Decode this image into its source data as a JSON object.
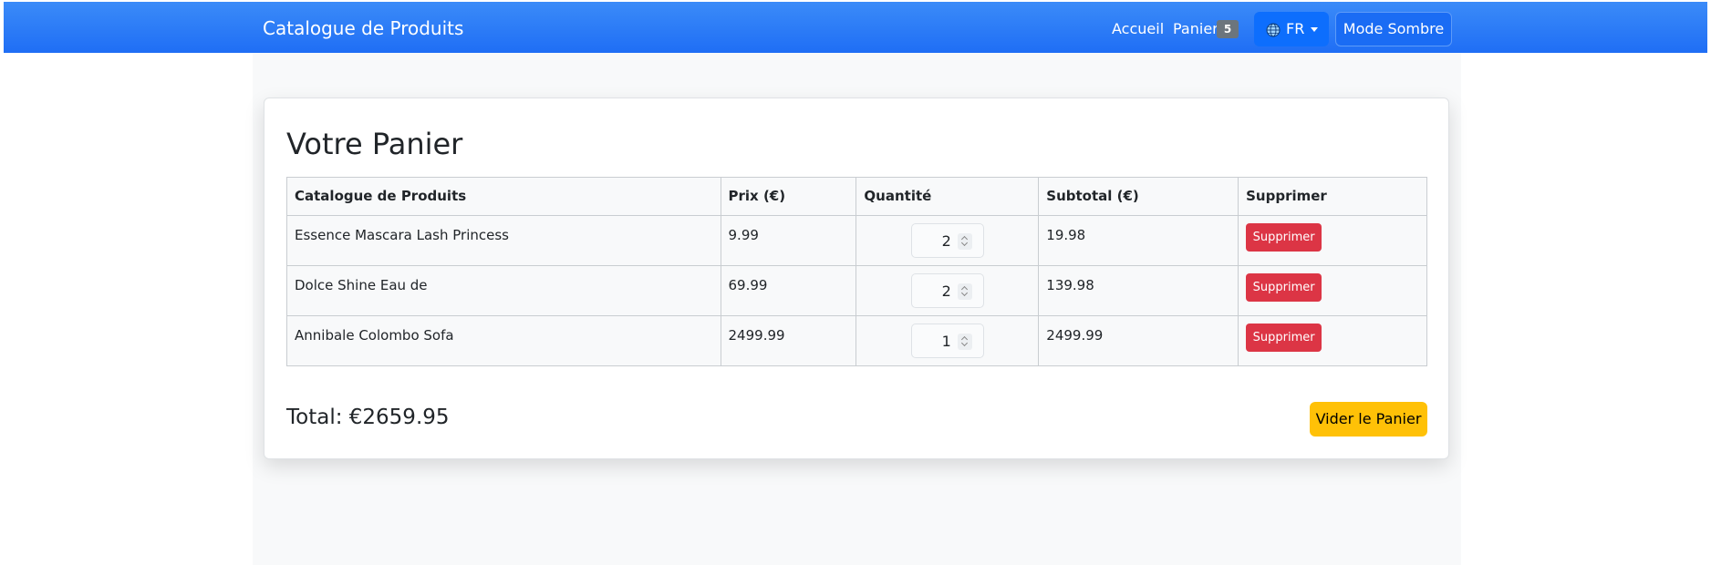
{
  "navbar": {
    "brand": "Catalogue de Produits",
    "home_label": "Accueil",
    "cart_label": "Panier",
    "cart_count": "5",
    "language_label": "FR",
    "language_icon": "globe-icon",
    "dark_mode_label": "Mode Sombre"
  },
  "cart": {
    "title": "Votre Panier",
    "columns": {
      "product": "Catalogue de Produits",
      "price": "Prix (€)",
      "quantity": "Quantité",
      "subtotal": "Subtotal (€)",
      "remove": "Supprimer"
    },
    "rows": [
      {
        "product": "Essence Mascara Lash Princess",
        "price": "9.99",
        "quantity": "2",
        "subtotal": "19.98",
        "remove_label": "Supprimer"
      },
      {
        "product": "Dolce Shine Eau de",
        "price": "69.99",
        "quantity": "2",
        "subtotal": "139.98",
        "remove_label": "Supprimer"
      },
      {
        "product": "Annibale Colombo Sofa",
        "price": "2499.99",
        "quantity": "1",
        "subtotal": "2499.99",
        "remove_label": "Supprimer"
      }
    ],
    "total_label": "Total: €2659.95",
    "clear_label": "Vider le Panier"
  },
  "colors": {
    "navbar": "#1f6ef5",
    "danger": "#dc3545",
    "warning": "#ffc107",
    "badge": "#6c757d"
  }
}
